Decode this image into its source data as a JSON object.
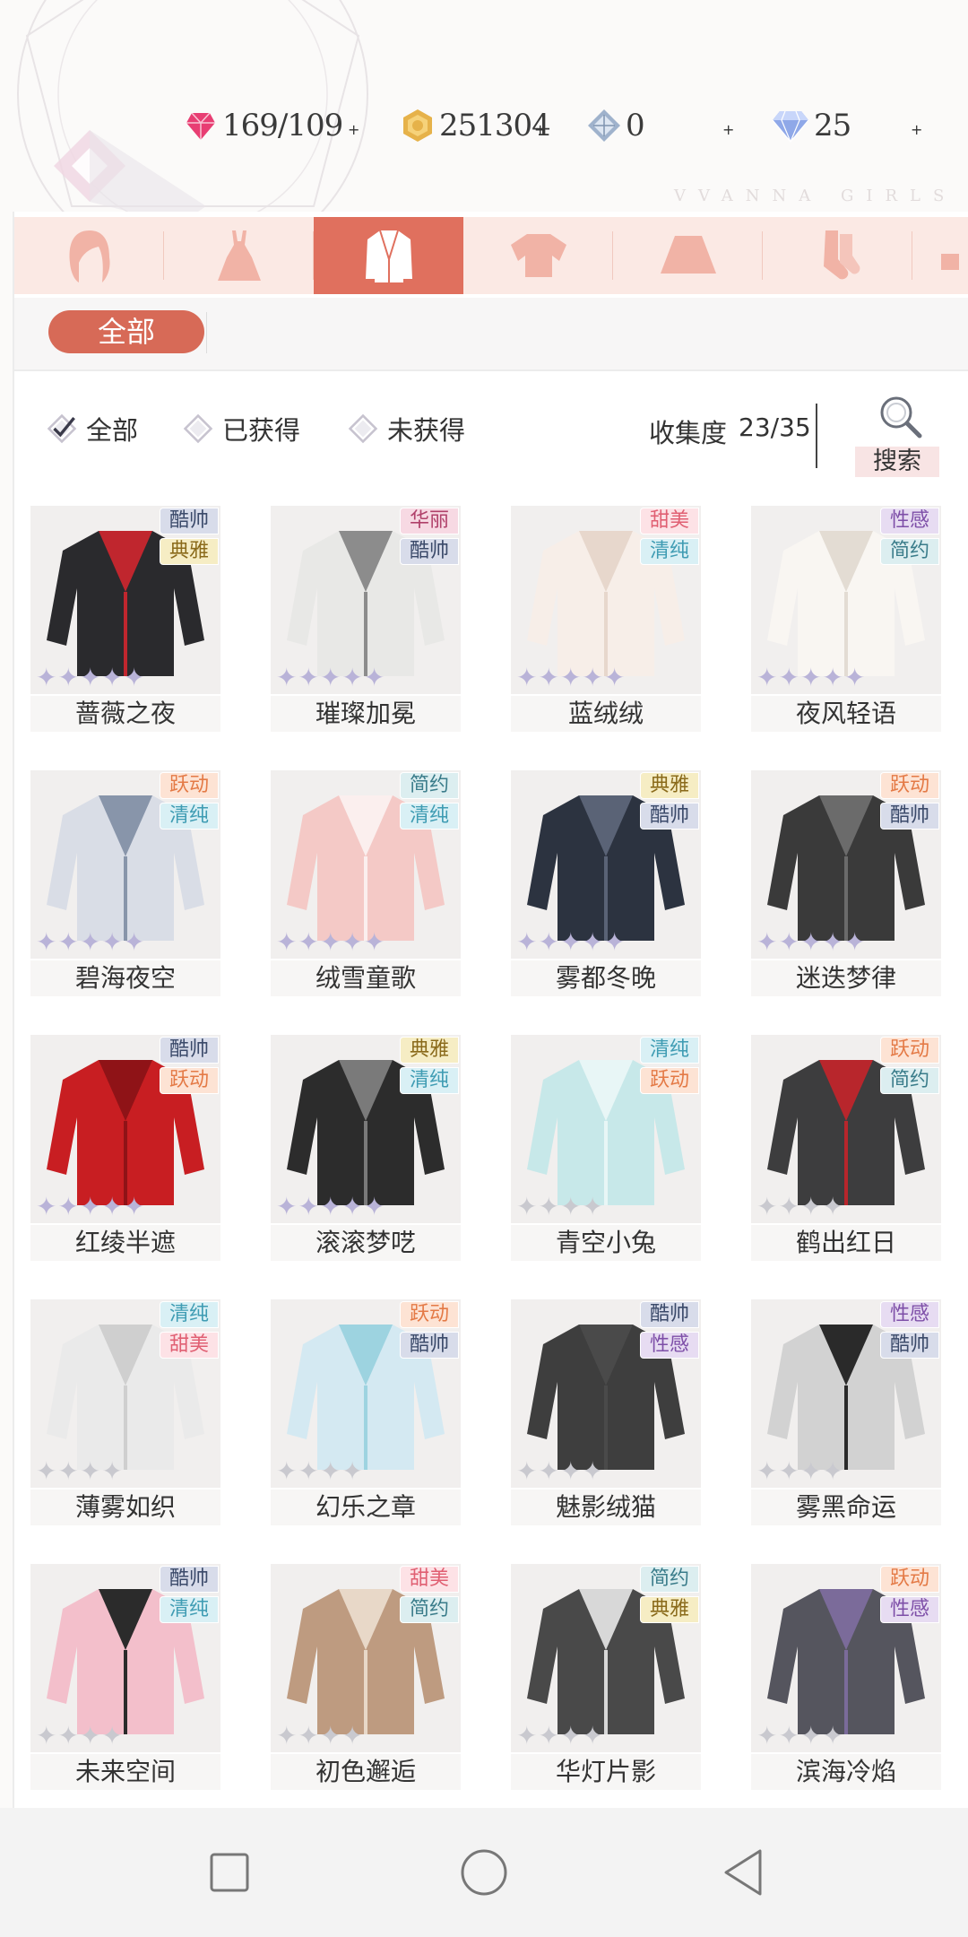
{
  "resources": [
    {
      "icon": "heart-gem-icon",
      "value": "169/109"
    },
    {
      "icon": "gold-coin-icon",
      "value": "251304"
    },
    {
      "icon": "crystal-icon",
      "value": "0"
    },
    {
      "icon": "diamond-icon",
      "value": "25"
    }
  ],
  "brand": "VVANNA GIRLS",
  "categories": [
    {
      "icon": "hair-icon",
      "label": "hair"
    },
    {
      "icon": "dress-icon",
      "label": "dress"
    },
    {
      "icon": "coat-icon",
      "label": "coat"
    },
    {
      "icon": "top-icon",
      "label": "top"
    },
    {
      "icon": "skirt-icon",
      "label": "skirt"
    },
    {
      "icon": "socks-icon",
      "label": "socks"
    }
  ],
  "active_category": 2,
  "filter": {
    "all_label": "全部"
  },
  "options": {
    "all": "全部",
    "owned": "已获得",
    "not_owned": "未获得",
    "selected": "all"
  },
  "collection": {
    "label": "收集度",
    "value": "23/35"
  },
  "search_label": "搜索",
  "tag_colors": {
    "酷帅": {
      "bg": "#d8dcea",
      "fg": "#3b4a6a"
    },
    "典雅": {
      "bg": "#f6edc4",
      "fg": "#8a6a1a"
    },
    "华丽": {
      "bg": "#f7d9e3",
      "fg": "#b0406a"
    },
    "甜美": {
      "bg": "#fde2e6",
      "fg": "#e05f72"
    },
    "清纯": {
      "bg": "#d9f0f5",
      "fg": "#3f9cb3"
    },
    "性感": {
      "bg": "#e7dcf2",
      "fg": "#7e4fa8"
    },
    "简约": {
      "bg": "#dceef0",
      "fg": "#3a7c8a"
    },
    "跃动": {
      "bg": "#fde3d4",
      "fg": "#e47a46"
    }
  },
  "items": [
    {
      "name": "蔷薇之夜",
      "tags": [
        "酷帅",
        "典雅"
      ],
      "stars": 5,
      "owned": true,
      "palette": [
        "#2a2a2d",
        "#c0262e"
      ]
    },
    {
      "name": "璀璨加冕",
      "tags": [
        "华丽",
        "酷帅"
      ],
      "stars": 5,
      "owned": true,
      "palette": [
        "#e8e8e6",
        "#8c8c8c"
      ]
    },
    {
      "name": "蓝绒绒",
      "tags": [
        "甜美",
        "清纯"
      ],
      "stars": 5,
      "owned": true,
      "palette": [
        "#f7eee8",
        "#e7d7cc"
      ]
    },
    {
      "name": "夜风轻语",
      "tags": [
        "性感",
        "简约"
      ],
      "stars": 5,
      "owned": true,
      "palette": [
        "#f9f6f2",
        "#e3dcd3"
      ]
    },
    {
      "name": "碧海夜空",
      "tags": [
        "跃动",
        "清纯"
      ],
      "stars": 5,
      "owned": true,
      "palette": [
        "#d9dde6",
        "#8895aa"
      ]
    },
    {
      "name": "绒雪童歌",
      "tags": [
        "简约",
        "清纯"
      ],
      "stars": 5,
      "owned": true,
      "palette": [
        "#f4c9c6",
        "#fbefee"
      ]
    },
    {
      "name": "雾都冬晚",
      "tags": [
        "典雅",
        "酷帅"
      ],
      "stars": 5,
      "owned": true,
      "palette": [
        "#2c3340",
        "#5a6376"
      ]
    },
    {
      "name": "迷迭梦律",
      "tags": [
        "跃动",
        "酷帅"
      ],
      "stars": 5,
      "owned": true,
      "palette": [
        "#3a3a3a",
        "#6b6b6b"
      ]
    },
    {
      "name": "红绫半遮",
      "tags": [
        "酷帅",
        "跃动"
      ],
      "stars": 5,
      "owned": true,
      "palette": [
        "#c81e22",
        "#8f1317"
      ]
    },
    {
      "name": "滚滚梦呓",
      "tags": [
        "典雅",
        "清纯"
      ],
      "stars": 5,
      "owned": true,
      "palette": [
        "#2c2c2c",
        "#7a7a7a"
      ]
    },
    {
      "name": "青空小兔",
      "tags": [
        "清纯",
        "跃动"
      ],
      "stars": 4,
      "owned": false,
      "palette": [
        "#bfe6e8",
        "#e8f6f6"
      ]
    },
    {
      "name": "鹤出红日",
      "tags": [
        "跃动",
        "简约"
      ],
      "stars": 4,
      "owned": false,
      "palette": [
        "#1d1d1f",
        "#b8262c"
      ]
    },
    {
      "name": "薄雾如织",
      "tags": [
        "清纯",
        "甜美"
      ],
      "stars": 4,
      "owned": false,
      "palette": [
        "#e9e9e9",
        "#cfcfcf"
      ]
    },
    {
      "name": "幻乐之章",
      "tags": [
        "跃动",
        "酷帅"
      ],
      "stars": 4,
      "owned": false,
      "palette": [
        "#cfe8f2",
        "#9dd3e0"
      ]
    },
    {
      "name": "魅影绒猫",
      "tags": [
        "酷帅",
        "性感"
      ],
      "stars": 4,
      "owned": false,
      "palette": [
        "#1f1f1f",
        "#4a4a4a"
      ]
    },
    {
      "name": "雾黑命运",
      "tags": [
        "性感",
        "酷帅"
      ],
      "stars": 4,
      "owned": false,
      "palette": [
        "#cdcdcd",
        "#2a2a2a"
      ]
    },
    {
      "name": "未来空间",
      "tags": [
        "酷帅",
        "清纯"
      ],
      "stars": 4,
      "owned": false,
      "palette": [
        "#f3b6c4",
        "#2b2b2b"
      ]
    },
    {
      "name": "初色邂逅",
      "tags": [
        "甜美",
        "简约"
      ],
      "stars": 4,
      "owned": false,
      "palette": [
        "#b58c6c",
        "#e8d8c8"
      ]
    },
    {
      "name": "华灯片影",
      "tags": [
        "简约",
        "典雅"
      ],
      "stars": 4,
      "owned": false,
      "palette": [
        "#2b2b2b",
        "#d8d8d8"
      ]
    },
    {
      "name": "滨海冷焰",
      "tags": [
        "跃动",
        "性感"
      ],
      "stars": 4,
      "owned": false,
      "palette": [
        "#3a3a44",
        "#7b6b9a"
      ]
    }
  ],
  "nav": {
    "recent": "recent-apps-icon",
    "home": "home-icon",
    "back": "back-icon"
  }
}
